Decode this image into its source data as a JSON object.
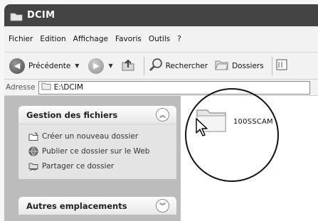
{
  "window": {
    "title": "DCIM"
  },
  "menu": [
    "Fichier",
    "Edition",
    "Affichage",
    "Favoris",
    "Outils",
    "?"
  ],
  "toolbar": {
    "back_label": "Précédente",
    "search_label": "Rechercher",
    "folders_label": "Dossiers"
  },
  "address": {
    "label": "Adresse",
    "value": "E:\\DCIM"
  },
  "left_panel": {
    "file_tasks": {
      "title": "Gestion des fichiers",
      "items": [
        "Créer un nouveau dossier",
        "Publier ce dossier sur le Web",
        "Partager ce dossier"
      ]
    },
    "other_places": {
      "title": "Autres emplacements"
    }
  },
  "content": {
    "folders": [
      {
        "name": "100SSCAM"
      }
    ]
  }
}
